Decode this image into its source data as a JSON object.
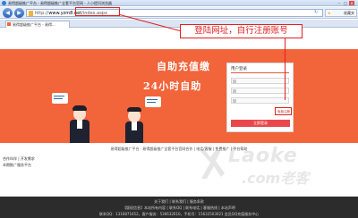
{
  "browser": {
    "window_title": "易得超级推广平台 - 易得超级推广全套平台官网 - 人小提问浏览器",
    "address_url_prefix": "http://",
    "address_url_domain": "www.yzm8.net",
    "address_url_path": "/index.aspx",
    "bookmarks_label": "收藏夹",
    "tab_title": "易得超级推广平台 - 易得...",
    "win_min": "–",
    "win_max": "□",
    "win_close": "×",
    "back_glyph": "◀",
    "forward_glyph": "▶",
    "refresh_glyph": "↻",
    "star_glyph": "★"
  },
  "annotation": {
    "callout_text": "登陆网址，自行注册账号"
  },
  "hero": {
    "line1": "自助充值缴",
    "line2": "24小时自助"
  },
  "login": {
    "header": "用户登录",
    "register_link": "免费注册",
    "button_label": "立即登录"
  },
  "links": {
    "row_text": "易得超级推广平台 · 易得超级推广全套平台官网合作 | 电话/客服 | 免费推广 | 平台帮助"
  },
  "sidebar_notes": {
    "note1": "合作伙伴 | 开发需求",
    "note2": "本期推广服务平台"
  },
  "footer": {
    "line1": "关于我们 | 联系我们 | 服务条款",
    "line2": "【版权信息】本站所有内容 | 联系QQ | 联系电话 | 客服热线 | 本站声明",
    "line3": "联系QQ：1316871652，客户服务：536632610，手机号：15632503021 会员QQ充值服务中心"
  },
  "watermark": {
    "brand": "Laoke",
    "domain": ".com老客"
  },
  "colors": {
    "hero_orange": "#f2643a",
    "annotation_red": "#e02020",
    "login_button": "#e9474c",
    "footer_bg": "#2c2c2c"
  }
}
